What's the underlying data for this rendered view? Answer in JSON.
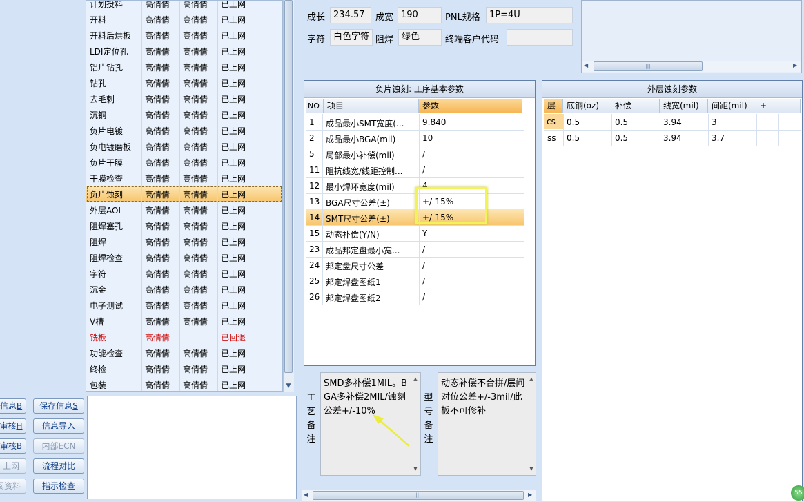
{
  "process_list": {
    "rows": [
      {
        "name": "计划投料",
        "c2": "高倩倩",
        "c3": "高倩倩",
        "status": "已上网"
      },
      {
        "name": "开料",
        "c2": "高倩倩",
        "c3": "高倩倩",
        "status": "已上网"
      },
      {
        "name": "开料后烘板",
        "c2": "高倩倩",
        "c3": "高倩倩",
        "status": "已上网"
      },
      {
        "name": "LDI定位孔",
        "c2": "高倩倩",
        "c3": "高倩倩",
        "status": "已上网"
      },
      {
        "name": "铝片钻孔",
        "c2": "高倩倩",
        "c3": "高倩倩",
        "status": "已上网"
      },
      {
        "name": "钻孔",
        "c2": "高倩倩",
        "c3": "高倩倩",
        "status": "已上网"
      },
      {
        "name": "去毛刺",
        "c2": "高倩倩",
        "c3": "高倩倩",
        "status": "已上网"
      },
      {
        "name": "沉铜",
        "c2": "高倩倩",
        "c3": "高倩倩",
        "status": "已上网"
      },
      {
        "name": "负片电镀",
        "c2": "高倩倩",
        "c3": "高倩倩",
        "status": "已上网"
      },
      {
        "name": "负电镀磨板",
        "c2": "高倩倩",
        "c3": "高倩倩",
        "status": "已上网"
      },
      {
        "name": "负片干膜",
        "c2": "高倩倩",
        "c3": "高倩倩",
        "status": "已上网"
      },
      {
        "name": "干膜检查",
        "c2": "高倩倩",
        "c3": "高倩倩",
        "status": "已上网"
      },
      {
        "name": "负片蚀刻",
        "c2": "高倩倩",
        "c3": "高倩倩",
        "status": "已上网"
      },
      {
        "name": "外层AOI",
        "c2": "高倩倩",
        "c3": "高倩倩",
        "status": "已上网"
      },
      {
        "name": "阻焊塞孔",
        "c2": "高倩倩",
        "c3": "高倩倩",
        "status": "已上网"
      },
      {
        "name": "阻焊",
        "c2": "高倩倩",
        "c3": "高倩倩",
        "status": "已上网"
      },
      {
        "name": "阻焊检查",
        "c2": "高倩倩",
        "c3": "高倩倩",
        "status": "已上网"
      },
      {
        "name": "字符",
        "c2": "高倩倩",
        "c3": "高倩倩",
        "status": "已上网"
      },
      {
        "name": "沉金",
        "c2": "高倩倩",
        "c3": "高倩倩",
        "status": "已上网"
      },
      {
        "name": "电子测试",
        "c2": "高倩倩",
        "c3": "高倩倩",
        "status": "已上网"
      },
      {
        "name": "V槽",
        "c2": "高倩倩",
        "c3": "高倩倩",
        "status": "已上网"
      },
      {
        "name": "铣板",
        "c2": "高倩倩",
        "c3": "",
        "status": "已回退"
      },
      {
        "name": "功能检查",
        "c2": "高倩倩",
        "c3": "高倩倩",
        "status": "已上网"
      },
      {
        "name": "终检",
        "c2": "高倩倩",
        "c3": "高倩倩",
        "status": "已上网"
      },
      {
        "name": "包装",
        "c2": "高倩倩",
        "c3": "高倩倩",
        "status": "已上网"
      }
    ],
    "selected_index": 12,
    "returned_index": 21
  },
  "buttons": {
    "info": "信息",
    "info_key": "B",
    "save_info": "保存信息",
    "save_info_key": "S",
    "review": "审核",
    "review_key": "H",
    "import_info": "信息导入",
    "review2": "审核",
    "review2_key": "B",
    "internal_ecn": "内部ECN",
    "upload": "上网",
    "flow_compare": "流程对比",
    "docs": "阅资料",
    "indicate_check": "指示检查"
  },
  "top_info": {
    "length_label": "成长",
    "length_value": "234.57",
    "width_label": "成宽",
    "width_value": "190",
    "pnl_label": "PNL规格",
    "pnl_value": "1P=4U",
    "char_label": "字符",
    "char_value": "白色字符",
    "mask_label": "阻焊",
    "mask_value": "绿色",
    "customer_label": "终端客户代码",
    "customer_value": ""
  },
  "param_table": {
    "title": "负片蚀刻: 工序基本参数",
    "headers": {
      "no": "NO",
      "item": "项目",
      "value": "参数"
    },
    "rows": [
      {
        "no": "1",
        "item": "成品最小SMT宽度(...",
        "value": "9.840"
      },
      {
        "no": "2",
        "item": "成品最小BGA(mil)",
        "value": "10"
      },
      {
        "no": "5",
        "item": "局部最小补偿(mil)",
        "value": "/"
      },
      {
        "no": "11",
        "item": "阻抗线宽/线距控制...",
        "value": "/"
      },
      {
        "no": "12",
        "item": "最小焊环宽度(mil)",
        "value": "4"
      },
      {
        "no": "13",
        "item": "BGA尺寸公差(±)",
        "value": "+/-15%"
      },
      {
        "no": "14",
        "item": "SMT尺寸公差(±)",
        "value": "+/-15%"
      },
      {
        "no": "15",
        "item": "动态补偿(Y/N)",
        "value": "Y"
      },
      {
        "no": "23",
        "item": "成品邦定盘最小宽...",
        "value": "/"
      },
      {
        "no": "24",
        "item": "邦定盘尺寸公差",
        "value": "/"
      },
      {
        "no": "25",
        "item": "邦定焊盘图纸1",
        "value": "/"
      },
      {
        "no": "26",
        "item": "邦定焊盘图纸2",
        "value": "/"
      }
    ],
    "selected_index": 6
  },
  "outer_table": {
    "title": "外层蚀刻参数",
    "headers": {
      "layer": "层",
      "base_cu": "底铜(oz)",
      "comp": "补偿",
      "line_width": "线宽(mil)",
      "spacing": "间距(mil)",
      "add": "+",
      "remove": "-"
    },
    "rows": [
      {
        "layer": "cs",
        "base_cu": "0.5",
        "comp": "0.5",
        "line_width": "3.94",
        "spacing": "3"
      },
      {
        "layer": "ss",
        "base_cu": "0.5",
        "comp": "0.5",
        "line_width": "3.94",
        "spacing": "3.7"
      }
    ]
  },
  "remarks": {
    "process_label": "工艺备注",
    "process_text": "SMD多补偿1MIL。BGA多补偿2MIL/蚀刻公差+/-10%",
    "model_label": "型号备注",
    "model_text": "动态补偿不合拼/层间对位公差+/-3mil/此板不可修补"
  },
  "colors": {
    "accent_orange": "#f7c56d",
    "highlight_yellow": "#f2f25a",
    "returned_red": "#d01010",
    "button_text": "#15428b"
  },
  "icons": {
    "scroll_up": "▲",
    "scroll_down": "▼",
    "scroll_left": "◀",
    "scroll_right": "▶",
    "grip": "|||",
    "status_badge": "55"
  }
}
